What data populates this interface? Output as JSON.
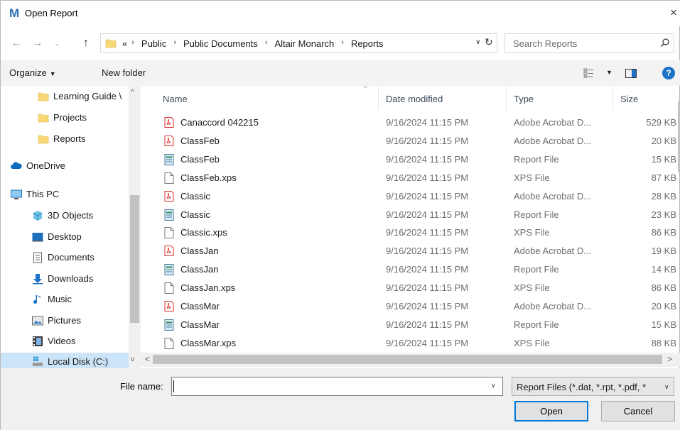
{
  "window": {
    "title": "Open Report",
    "app_logo_letter": "M",
    "close_symbol": "×"
  },
  "navigation": {
    "back_symbol": "←",
    "forward_symbol": "→",
    "recent_symbol": "⌄",
    "up_symbol": "↑",
    "address_prefix": "«",
    "breadcrumbs": [
      "Public",
      "Public Documents",
      "Altair Monarch",
      "Reports"
    ],
    "address_dropdown_symbol": "∨",
    "refresh_symbol": "↻",
    "search_placeholder": "Search Reports"
  },
  "toolbar": {
    "organize_label": "Organize",
    "organize_caret": "▼",
    "new_folder_label": "New folder",
    "view_caret": "▼",
    "help_label": "?"
  },
  "sidebar": {
    "items": [
      {
        "label": "Learning Guide \\",
        "icon": "folder-icon",
        "selected": false
      },
      {
        "label": "Projects",
        "icon": "folder-icon",
        "selected": false
      },
      {
        "label": "Reports",
        "icon": "folder-icon",
        "selected": false
      },
      {
        "label": "OneDrive",
        "icon": "cloud-icon",
        "selected": false
      },
      {
        "label": "This PC",
        "icon": "computer-icon",
        "selected": false
      },
      {
        "label": "3D Objects",
        "icon": "cube-icon",
        "selected": false
      },
      {
        "label": "Desktop",
        "icon": "desktop-icon",
        "selected": false
      },
      {
        "label": "Documents",
        "icon": "document-icon",
        "selected": false
      },
      {
        "label": "Downloads",
        "icon": "download-icon",
        "selected": false
      },
      {
        "label": "Music",
        "icon": "music-icon",
        "selected": false
      },
      {
        "label": "Pictures",
        "icon": "picture-icon",
        "selected": false
      },
      {
        "label": "Videos",
        "icon": "video-icon",
        "selected": false
      },
      {
        "label": "Local Disk (C:)",
        "icon": "disk-icon",
        "selected": true
      }
    ],
    "scroll_up_symbol": "^",
    "scroll_down_symbol": "v"
  },
  "file_list": {
    "columns": {
      "name": "Name",
      "date": "Date modified",
      "type": "Type",
      "size": "Size"
    },
    "sort_indicator": "^",
    "rows": [
      {
        "name": "Canaccord 042215",
        "date": "9/16/2024 11:15 PM",
        "type": "Adobe Acrobat D...",
        "size": "529 KB",
        "icon": "pdf-icon"
      },
      {
        "name": "ClassFeb",
        "date": "9/16/2024 11:15 PM",
        "type": "Adobe Acrobat D...",
        "size": "20 KB",
        "icon": "pdf-icon"
      },
      {
        "name": "ClassFeb",
        "date": "9/16/2024 11:15 PM",
        "type": "Report File",
        "size": "15 KB",
        "icon": "report-file-icon"
      },
      {
        "name": "ClassFeb.xps",
        "date": "9/16/2024 11:15 PM",
        "type": "XPS File",
        "size": "87 KB",
        "icon": "blank-file-icon"
      },
      {
        "name": "Classic",
        "date": "9/16/2024 11:15 PM",
        "type": "Adobe Acrobat D...",
        "size": "28 KB",
        "icon": "pdf-icon"
      },
      {
        "name": "Classic",
        "date": "9/16/2024 11:15 PM",
        "type": "Report File",
        "size": "23 KB",
        "icon": "report-file-icon"
      },
      {
        "name": "Classic.xps",
        "date": "9/16/2024 11:15 PM",
        "type": "XPS File",
        "size": "86 KB",
        "icon": "blank-file-icon"
      },
      {
        "name": "ClassJan",
        "date": "9/16/2024 11:15 PM",
        "type": "Adobe Acrobat D...",
        "size": "19 KB",
        "icon": "pdf-icon"
      },
      {
        "name": "ClassJan",
        "date": "9/16/2024 11:15 PM",
        "type": "Report File",
        "size": "14 KB",
        "icon": "report-file-icon"
      },
      {
        "name": "ClassJan.xps",
        "date": "9/16/2024 11:15 PM",
        "type": "XPS File",
        "size": "86 KB",
        "icon": "blank-file-icon"
      },
      {
        "name": "ClassMar",
        "date": "9/16/2024 11:15 PM",
        "type": "Adobe Acrobat D...",
        "size": "20 KB",
        "icon": "pdf-icon"
      },
      {
        "name": "ClassMar",
        "date": "9/16/2024 11:15 PM",
        "type": "Report File",
        "size": "15 KB",
        "icon": "report-file-icon"
      },
      {
        "name": "ClassMar.xps",
        "date": "9/16/2024 11:15 PM",
        "type": "XPS File",
        "size": "88 KB",
        "icon": "blank-file-icon"
      }
    ],
    "hscroll_left_symbol": "<",
    "hscroll_right_symbol": ">"
  },
  "footer": {
    "file_name_label": "File name:",
    "file_name_value": "",
    "file_name_dropdown_symbol": "∨",
    "filter_value": "Report Files (*.dat, *.rpt, *.pdf, *",
    "filter_dropdown_symbol": "∨",
    "open_label": "Open",
    "cancel_label": "Cancel"
  },
  "colors": {
    "accent": "#0078d7",
    "selection": "#cce4f7",
    "folder": "#f8d775",
    "pdf": "#d9302c",
    "help": "#1e73c8"
  }
}
